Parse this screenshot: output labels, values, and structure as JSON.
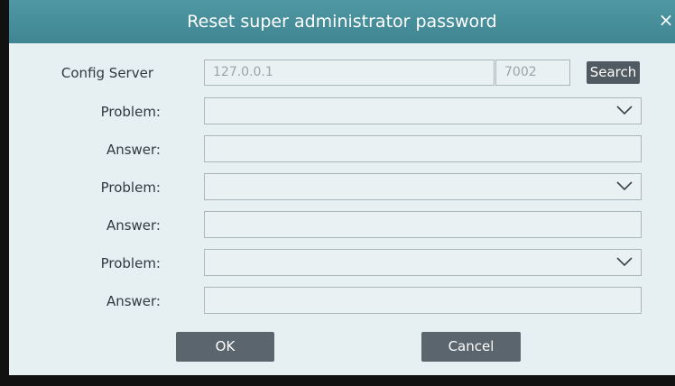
{
  "dialog": {
    "title": "Reset super administrator password",
    "close_glyph": "×"
  },
  "config_server": {
    "label": "Config Server",
    "ip_value": "127.0.0.1",
    "port_value": "7002",
    "search_label": "Search"
  },
  "questions": [
    {
      "problem_label": "Problem:",
      "problem_value": "",
      "answer_label": "Answer:",
      "answer_value": ""
    },
    {
      "problem_label": "Problem:",
      "problem_value": "",
      "answer_label": "Answer:",
      "answer_value": ""
    },
    {
      "problem_label": "Problem:",
      "problem_value": "",
      "answer_label": "Answer:",
      "answer_value": ""
    }
  ],
  "buttons": {
    "ok_label": "OK",
    "cancel_label": "Cancel"
  },
  "icons": {
    "close": "close-icon",
    "dropdown": "chevron-down-icon"
  },
  "colors": {
    "title_bar": "#4a919d",
    "button": "#5a656d",
    "background": "#e6eff1"
  }
}
